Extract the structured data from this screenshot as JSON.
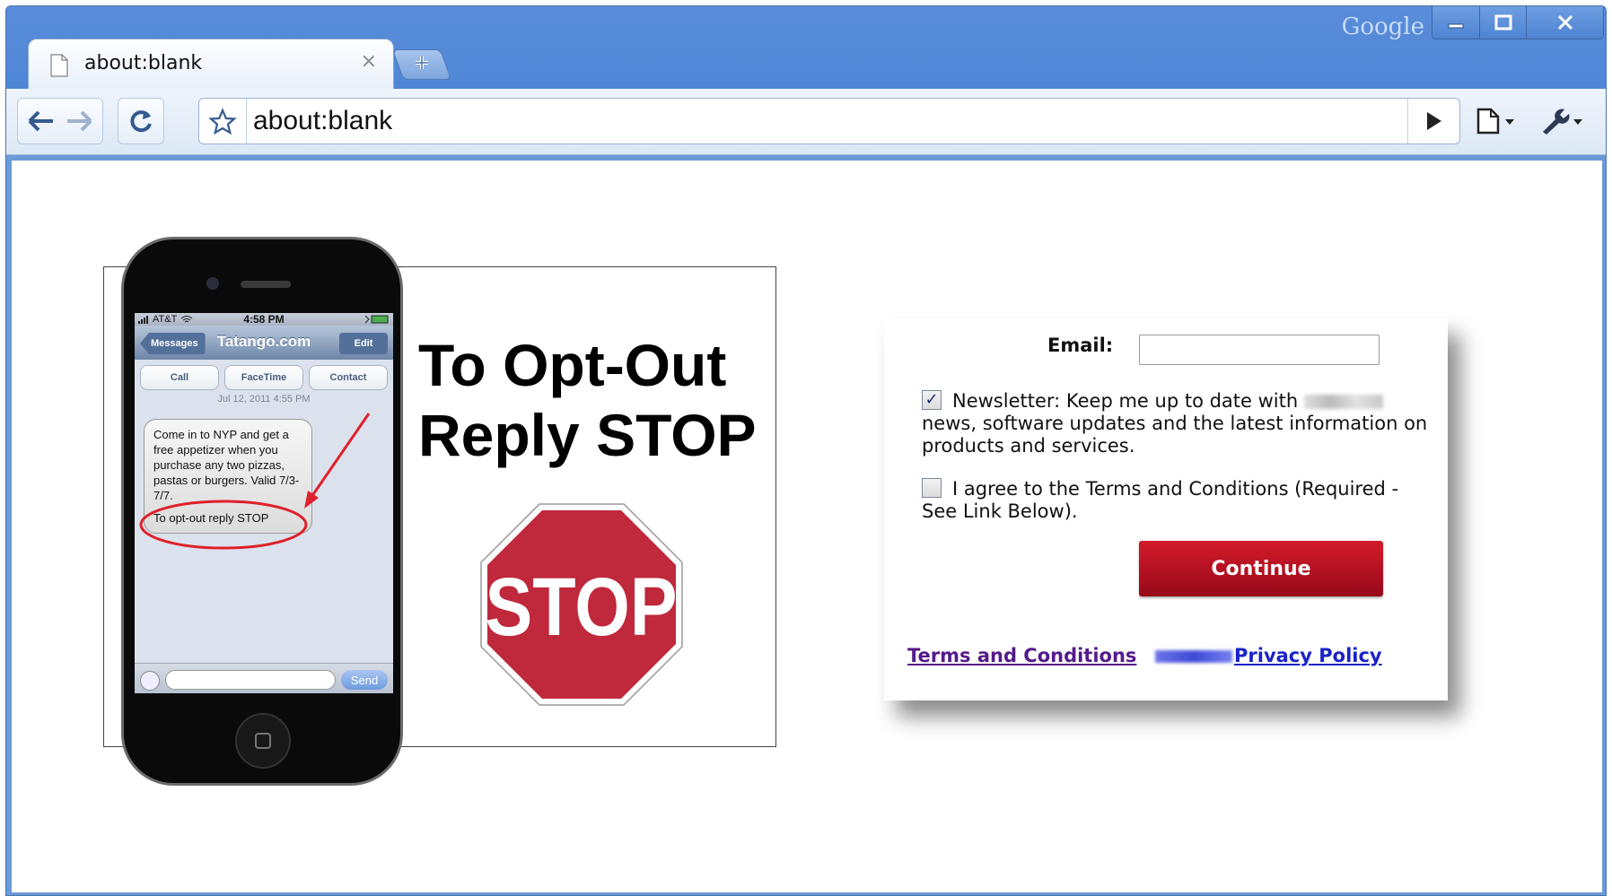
{
  "browser": {
    "brand": "Google",
    "tab_title": "about:blank",
    "tab_close": "×",
    "url": "about:blank"
  },
  "phone": {
    "carrier": "AT&T",
    "time": "4:58 PM",
    "back_button": "Messages",
    "nav_title": "Tatango.com",
    "edit_button": "Edit",
    "actions": [
      "Call",
      "FaceTime",
      "Contact"
    ],
    "timestamp": "Jul 12, 2011 4:55 PM",
    "message_body": "Come in to NYP and get a free appetizer when you purchase any two pizzas, pastas or burgers. Valid 7/3-7/7.",
    "message_optout": "To opt-out reply STOP",
    "send_button": "Send"
  },
  "optout": {
    "heading_line1": "To Opt-Out",
    "heading_line2": "Reply STOP",
    "sign_text": "STOP"
  },
  "form": {
    "email_label": "Email:",
    "email_value": "",
    "newsletter_checked": true,
    "newsletter_text_before": "Newsletter: Keep me up to date with",
    "newsletter_text_after": "news, software updates and the latest information on products and services.",
    "terms_checked": false,
    "terms_text": "I agree to the Terms and Conditions (Required - See Link Below).",
    "continue_button": "Continue",
    "terms_link": "Terms and Conditions",
    "privacy_link": "Privacy Policy"
  },
  "colors": {
    "chrome_blue": "#4f86d6",
    "stop_red": "#c0283c",
    "continue_red": "#b30f22",
    "annotation_red": "#e0202a"
  }
}
